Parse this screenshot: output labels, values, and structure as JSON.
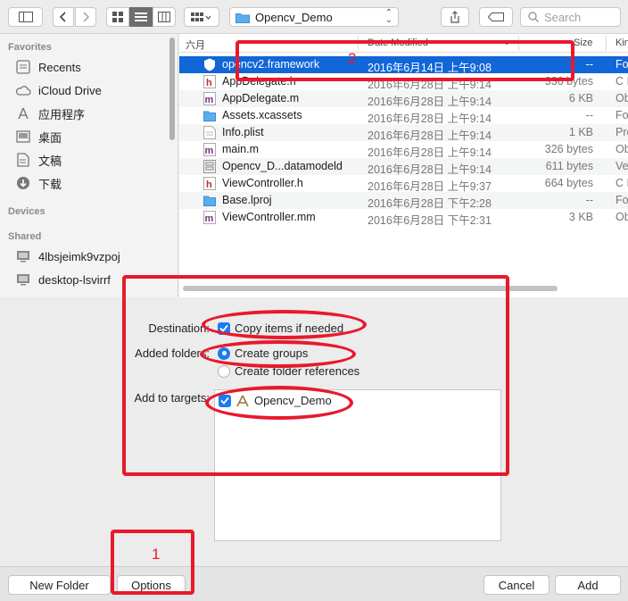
{
  "toolbar": {
    "location": "Opencv_Demo",
    "search_placeholder": "Search"
  },
  "sidebar": {
    "favorites_header": "Favorites",
    "favorites": [
      {
        "label": "Recents",
        "icon": "clock-icon"
      },
      {
        "label": "iCloud Drive",
        "icon": "cloud-icon"
      },
      {
        "label": "应用程序",
        "icon": "applications-icon"
      },
      {
        "label": "桌面",
        "icon": "desktop-icon"
      },
      {
        "label": "文稿",
        "icon": "documents-icon"
      },
      {
        "label": "下载",
        "icon": "download-icon"
      }
    ],
    "devices_header": "Devices",
    "shared_header": "Shared",
    "shared": [
      {
        "label": "4lbsjeimk9vzpoj",
        "icon": "computer-icon"
      },
      {
        "label": "desktop-lsvirrf",
        "icon": "computer-icon"
      }
    ]
  },
  "filelist": {
    "columns": {
      "name": "六月",
      "date": "Date Modified",
      "size": "Size",
      "kind": "Kin"
    },
    "rows": [
      {
        "name": "opencv2.framework",
        "date": "2016年6月14日 上午9:08",
        "size": "--",
        "kind": "Fo",
        "icon": "framework-icon",
        "selected": true
      },
      {
        "name": "AppDelegate.h",
        "date": "2016年6月28日 上午9:14",
        "size": "336 bytes",
        "kind": "C I",
        "icon": "header-file-icon"
      },
      {
        "name": "AppDelegate.m",
        "date": "2016年6月28日 上午9:14",
        "size": "6 KB",
        "kind": "Ob",
        "icon": "source-file-icon"
      },
      {
        "name": "Assets.xcassets",
        "date": "2016年6月28日 上午9:14",
        "size": "--",
        "kind": "Fo",
        "icon": "folder-icon"
      },
      {
        "name": "Info.plist",
        "date": "2016年6月28日 上午9:14",
        "size": "1 KB",
        "kind": "Pro",
        "icon": "plist-icon"
      },
      {
        "name": "main.m",
        "date": "2016年6月28日 上午9:14",
        "size": "326 bytes",
        "kind": "Ob",
        "icon": "source-file-icon"
      },
      {
        "name": "Opencv_D...datamodeld",
        "date": "2016年6月28日 上午9:14",
        "size": "611 bytes",
        "kind": "Ve",
        "icon": "datamodel-icon"
      },
      {
        "name": "ViewController.h",
        "date": "2016年6月28日 上午9:37",
        "size": "664 bytes",
        "kind": "C I",
        "icon": "header-file-icon"
      },
      {
        "name": "Base.lproj",
        "date": "2016年6月28日 下午2:28",
        "size": "--",
        "kind": "Fo",
        "icon": "folder-icon"
      },
      {
        "name": "ViewController.mm",
        "date": "2016年6月28日 下午2:31",
        "size": "3 KB",
        "kind": "Ob",
        "icon": "source-file-icon"
      }
    ]
  },
  "options": {
    "destination_label": "Destination:",
    "copy_items": "Copy items if needed",
    "added_folders_label": "Added folders:",
    "create_groups": "Create groups",
    "create_folder_refs": "Create folder references",
    "targets_label": "Add to targets:",
    "target_name": "Opencv_Demo"
  },
  "buttons": {
    "new_folder": "New Folder",
    "options": "Options",
    "cancel": "Cancel",
    "add": "Add"
  },
  "annotations": {
    "num_1": "1",
    "num_2": "2",
    "color": "#e8192c"
  },
  "colors": {
    "selection": "#1166d8",
    "accent": "#1a7cf0"
  }
}
